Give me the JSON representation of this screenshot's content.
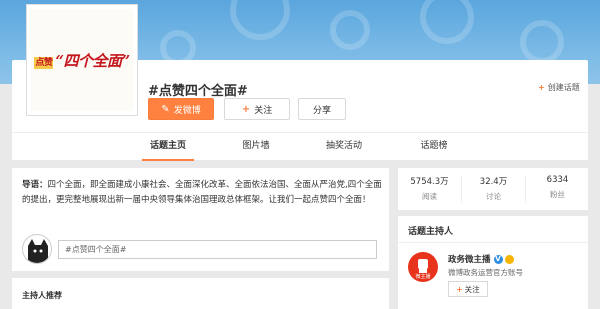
{
  "topic": {
    "cover_prefix": "点赞",
    "cover_text": "“四个全面”",
    "title": "#点赞四个全面#",
    "create_label": "创建话题",
    "actions": {
      "post_label": "发微博",
      "follow_label": "关注",
      "share_label": "分享"
    }
  },
  "tabs": [
    {
      "label": "话题主页",
      "active": true
    },
    {
      "label": "图片墙",
      "active": false
    },
    {
      "label": "抽奖活动",
      "active": false
    },
    {
      "label": "话题榜",
      "active": false
    }
  ],
  "intro": {
    "label": "导语：",
    "text": "四个全面，即全面建成小康社会、全面深化改革、全面依法治国、全面从严治党,四个全面的提出，更完整地展现出新一届中央领导集体治国理政总体框架。让我们一起点赞四个全面！"
  },
  "composer": {
    "value": "#点赞四个全面#"
  },
  "host_recommend": {
    "title": "主持人推荐"
  },
  "stats": [
    {
      "value": "5754.3万",
      "label": "阅读"
    },
    {
      "value": "32.4万",
      "label": "讨论"
    },
    {
      "value": "6334",
      "label": "粉丝"
    }
  ],
  "hosts": {
    "title": "话题主持人",
    "items": [
      {
        "name": "政务微主播",
        "desc": "微博政务运营官方账号",
        "follow_label": "关注",
        "avatar_text": "微主播"
      }
    ]
  },
  "colors": {
    "accent": "#ff8140",
    "banner": "#5aa6dd",
    "cover_red": "#c4161c",
    "host_avatar": "#e8341c"
  }
}
